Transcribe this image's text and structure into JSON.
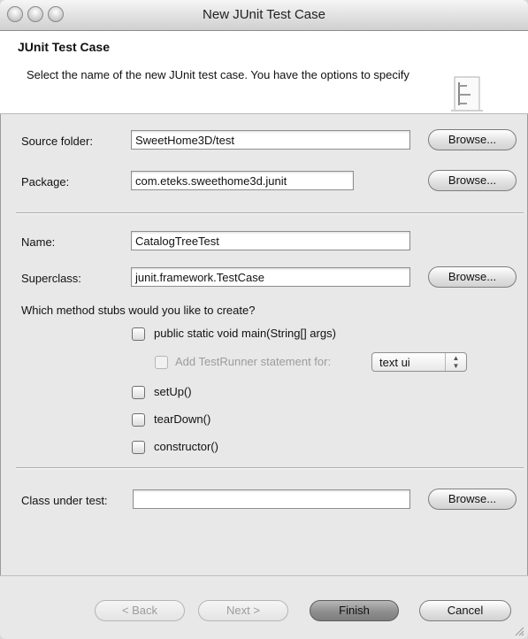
{
  "window": {
    "title": "New JUnit Test Case"
  },
  "header": {
    "title": "JUnit Test Case",
    "description": "Select the name of the new JUnit test case. You have the options to specify"
  },
  "form": {
    "source_folder": {
      "label": "Source folder:",
      "value": "SweetHome3D/test",
      "browse_label": "Browse..."
    },
    "package": {
      "label": "Package:",
      "value": "com.eteks.sweethome3d.junit",
      "browse_label": "Browse..."
    },
    "name": {
      "label": "Name:",
      "value": "CatalogTreeTest"
    },
    "superclass": {
      "label": "Superclass:",
      "value": "junit.framework.TestCase",
      "browse_label": "Browse..."
    },
    "stubs_question": "Which method stubs would you like to create?",
    "stubs": {
      "main": {
        "label": "public static void main(String[] args)",
        "checked": false
      },
      "test_runner": {
        "label": "Add TestRunner statement for:",
        "checked": false,
        "enabled": false,
        "selected_option": "text ui"
      },
      "setup": {
        "label": "setUp()",
        "checked": false
      },
      "teardown": {
        "label": "tearDown()",
        "checked": false
      },
      "constructor": {
        "label": "constructor()",
        "checked": false
      }
    },
    "class_under_test": {
      "label": "Class under test:",
      "value": "",
      "browse_label": "Browse..."
    }
  },
  "footer": {
    "back_label": "< Back",
    "next_label": "Next >",
    "finish_label": "Finish",
    "cancel_label": "Cancel"
  }
}
